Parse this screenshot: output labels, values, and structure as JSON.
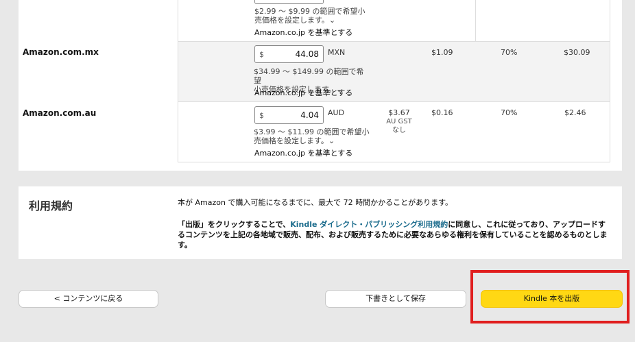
{
  "pricing": {
    "partial_row": {
      "range_line1": "$2.99 ～ $9.99 の範囲で希望小",
      "range_line2": "売価格を設定します。⌄",
      "base": "Amazon.co.jp を基準とする"
    },
    "rows": [
      {
        "marketplace": "Amazon.com.mx",
        "currency_symbol": "$",
        "price": "44.08",
        "currency": "MXN",
        "tax": "",
        "delivery": "$1.09",
        "royalty_rate": "70%",
        "royalty": "$30.09",
        "range_line1": "$34.99 ～ $149.99 の範囲で希望",
        "range_line2": "小売価格を設定します。⌄",
        "base": "Amazon.co.jp を基準とする"
      },
      {
        "marketplace": "Amazon.com.au",
        "currency_symbol": "$",
        "price": "4.04",
        "currency": "AUD",
        "tax": "$3.67",
        "tax_line2": "AU GST",
        "tax_line3": "なし",
        "delivery": "$0.16",
        "royalty_rate": "70%",
        "royalty": "$2.46",
        "range_line1": "$3.99 ～ $11.99 の範囲で希望小",
        "range_line2": "売価格を設定します。⌄",
        "base": "Amazon.co.jp を基準とする"
      }
    ]
  },
  "terms": {
    "title": "利用規約",
    "line1": "本が Amazon で購入可能になるまでに、最大で 72 時間かかることがあります。",
    "para_before": "「出版」をクリックすることで、",
    "para_link": "Kindle ダイレクト・パブリッシング利用規約",
    "para_after": "に同意し、これに従っており、アップロードするコンテンツを上記の各地域で販売、配布、および販売するために必要なあらゆる権利を保有していることを認めるものとします。"
  },
  "footer": {
    "back_label": "< コンテンツに戻る",
    "save_draft_label": "下書きとして保存",
    "publish_label": "Kindle 本を出版"
  },
  "colors": {
    "publish_button": "#ffd814",
    "highlight_box": "#e01e1e",
    "link": "#1a6b8c"
  }
}
